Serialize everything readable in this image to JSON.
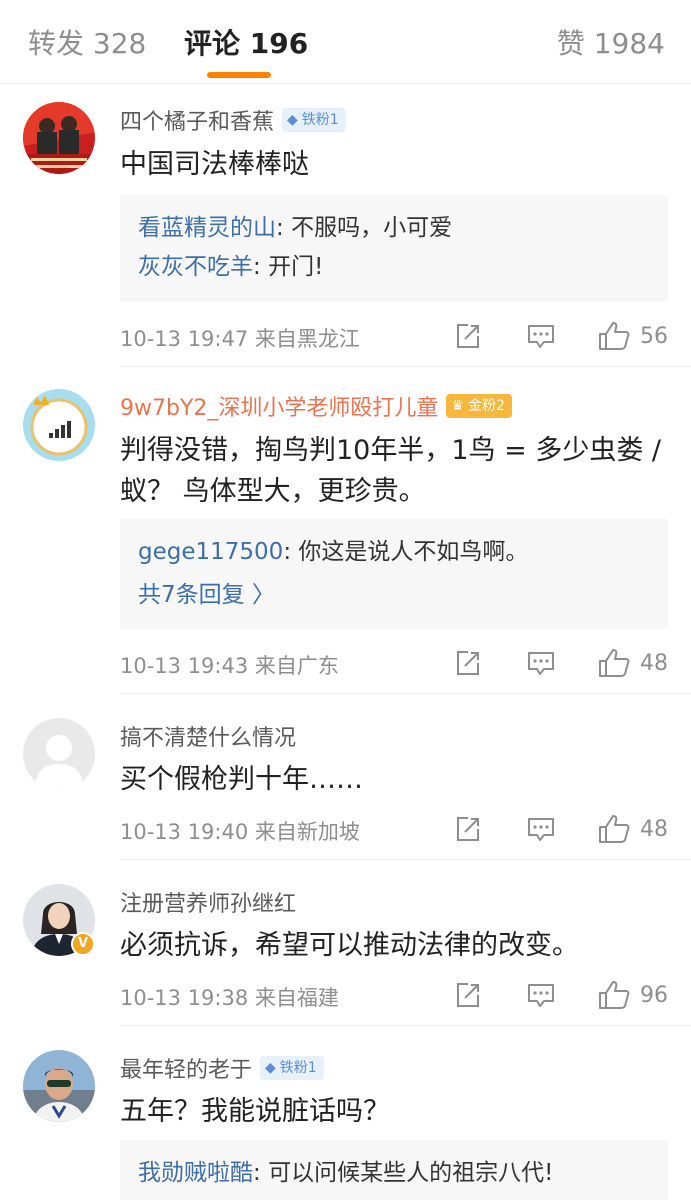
{
  "tabs": {
    "repost": "转发 328",
    "comments": "评论 196",
    "likes": "赞 1984"
  },
  "colors": {
    "accent": "#ff8200",
    "link": "#3e6ea7",
    "meta": "#8e8e8e",
    "gold_name": "#eb7350"
  },
  "comments": [
    {
      "avatar": "red-poster-avatar",
      "user": "四个橘子和香蕉",
      "badge": "铁粉1",
      "badge_type": "iron",
      "text": "中国司法棒棒哒",
      "replies": [
        {
          "user": "看蓝精灵的山",
          "sep": ": ",
          "text": "不服吗，小可爱"
        },
        {
          "user": "灰灰不吃羊",
          "sep": ": ",
          "text": "开门!"
        }
      ],
      "meta": "10-13 19:47  来自黑龙江",
      "likes": "56"
    },
    {
      "avatar": "signal-crown-avatar",
      "user": "9w7bY2_深圳小学老师殴打儿童",
      "badge": "金粉2",
      "badge_type": "gold",
      "text": "判得没错，掏鸟判10年半，1鸟 = 多少虫娄 / 蚁？ 鸟体型大，更珍贵。",
      "replies": [
        {
          "user": "gege117500",
          "sep": ": ",
          "text": "你这是说人不如鸟啊。"
        }
      ],
      "more_replies": "共7条回复 〉",
      "meta": "10-13 19:43  来自广东",
      "likes": "48"
    },
    {
      "avatar": "default-avatar",
      "user": "搞不清楚什么情况",
      "text": "买个假枪判十年……",
      "meta": "10-13 19:40  来自新加坡",
      "likes": "48"
    },
    {
      "avatar": "photo-avatar-woman",
      "verified": "V",
      "user": "注册营养师孙继红",
      "text": "必须抗诉，希望可以推动法律的改变。",
      "meta": "10-13 19:38  来自福建",
      "likes": "96"
    },
    {
      "avatar": "photo-avatar-man",
      "user": "最年轻的老于",
      "badge": "铁粉1",
      "badge_type": "iron",
      "text": "五年？我能说脏话吗？",
      "replies": [
        {
          "user": "我勋贼啦酷",
          "sep": ": ",
          "text": "可以问候某些人的祖宗八代!"
        }
      ]
    }
  ]
}
